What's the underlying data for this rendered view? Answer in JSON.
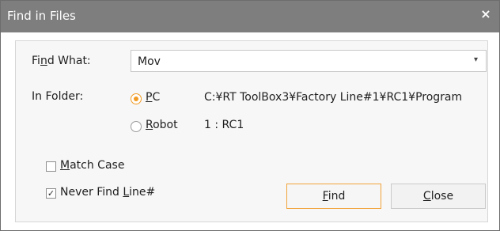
{
  "window": {
    "title": "Find in Files",
    "close_glyph": "×"
  },
  "find_what": {
    "label_before": "Fi",
    "label_u": "n",
    "label_after": "d What:",
    "value": "Mov"
  },
  "in_folder": {
    "label": "In Folder:",
    "options": [
      {
        "label_u": "P",
        "label_after": "C",
        "selected": true,
        "path": "C:¥RT ToolBox3¥Factory Line#1¥RC1¥Program"
      },
      {
        "label_u": "R",
        "label_after": "obot",
        "selected": false,
        "path": "1 : RC1"
      }
    ]
  },
  "options": {
    "match_case": {
      "label_u": "M",
      "label_after": "atch Case",
      "checked": false
    },
    "never_find_line": {
      "label_before": "Never Find ",
      "label_u": "L",
      "label_after": "ine#",
      "checked": true
    }
  },
  "buttons": {
    "find": {
      "label_u": "F",
      "label_after": "ind"
    },
    "close": {
      "label_u": "C",
      "label_after": "lose"
    }
  },
  "icons": {
    "dropdown_arrow": "▾",
    "checkmark": "✓"
  }
}
